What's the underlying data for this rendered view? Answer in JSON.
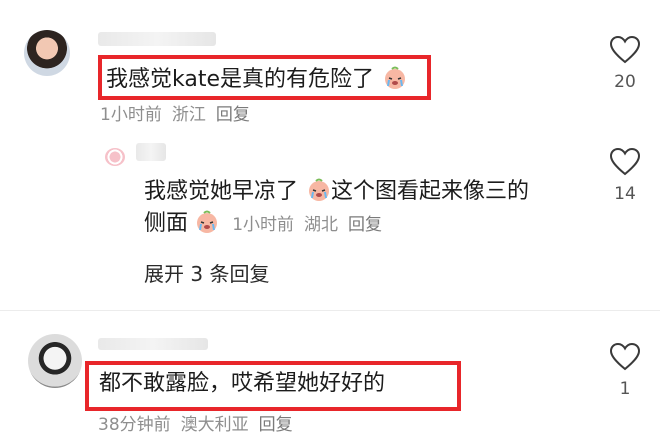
{
  "comments": [
    {
      "text": "我感觉kate是真的有危险了",
      "time": "1小时前",
      "location": "浙江",
      "reply_label": "回复",
      "likes": "20",
      "emoji": "crying-face-icon"
    },
    {
      "text_line1": "我感觉她早凉了",
      "text_line1b": "这个图看起来像三的",
      "text_line2": "侧面",
      "time": "1小时前",
      "location": "湖北",
      "reply_label": "回复",
      "likes": "14",
      "expand_label": "展开 3 条回复"
    },
    {
      "text": "都不敢露脸，哎希望她好好的",
      "time": "38分钟前",
      "location": "澳大利亚",
      "reply_label": "回复",
      "likes": "1"
    }
  ],
  "colors": {
    "highlight": "#e8262a",
    "meta": "#8e8e8e"
  }
}
